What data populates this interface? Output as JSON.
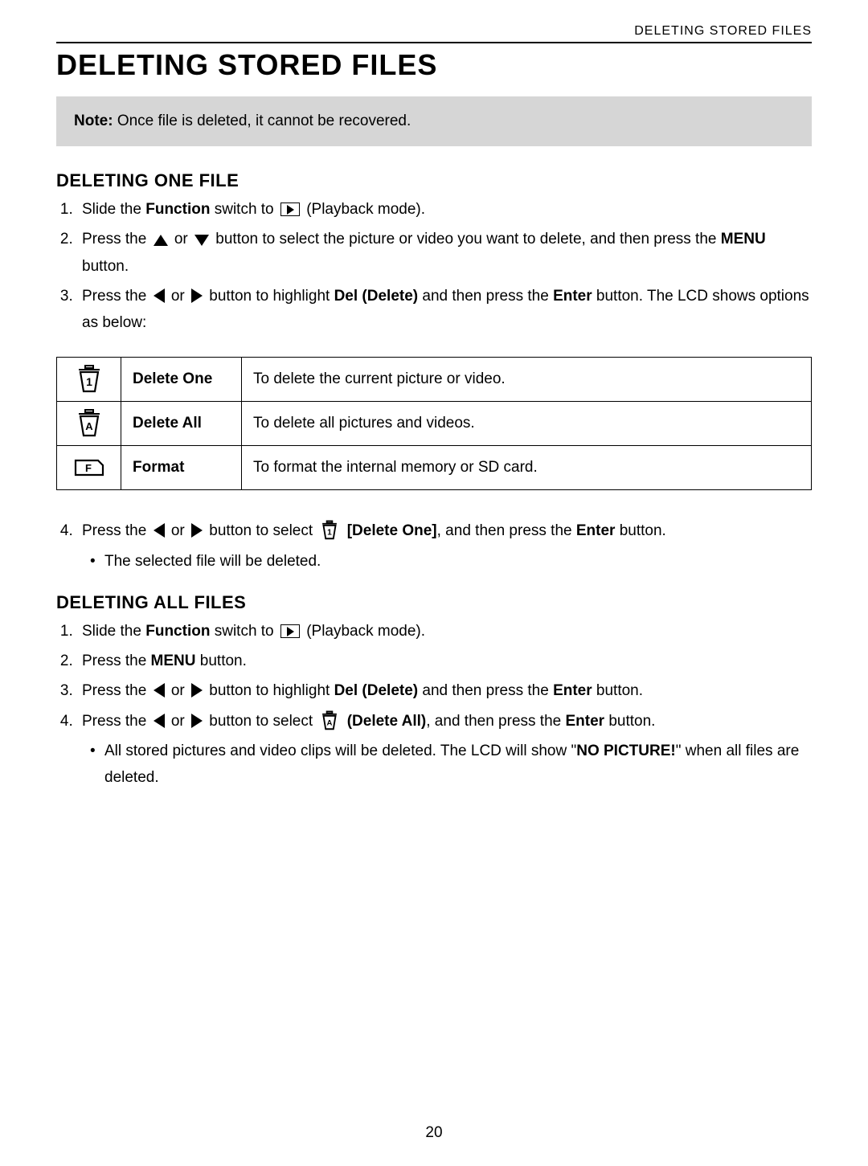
{
  "header": "DELETING STORED FILES",
  "title": "DELETING STORED FILES",
  "note_prefix": "Note:",
  "note_body": " Once file is deleted, it cannot be recovered.",
  "sec1_heading": "DELETING ONE FILE",
  "sec1": {
    "s1a": "Slide the ",
    "s1b": "Function",
    "s1c": " switch to ",
    "s1d": " (Playback mode).",
    "s2a": "Press the ",
    "s2b": " or ",
    "s2c": " button to select the picture or video you want to delete, and then press the ",
    "s2d": "MENU",
    "s2e": " button.",
    "s3a": "Press the ",
    "s3b": " or ",
    "s3c": " button to highlight ",
    "s3d": "Del (Delete)",
    "s3e": " and then press the ",
    "s3f": "Enter",
    "s3g": " button. The LCD shows options as below:",
    "s4a": "Press the ",
    "s4b": " or ",
    "s4c": " button to select ",
    "s4d": " [Delete One]",
    "s4e": ", and then press the ",
    "s4f": "Enter",
    "s4g": " button.",
    "s4_sub": "The selected file will be deleted."
  },
  "table": {
    "r1_label": "Delete One",
    "r1_desc": "To delete the current picture or video.",
    "r2_label": "Delete All",
    "r2_desc": "To delete all pictures and videos.",
    "r3_label": "Format",
    "r3_desc": "To format the internal memory or SD card."
  },
  "sec2_heading": "DELETING ALL FILES",
  "sec2": {
    "s1a": "Slide the ",
    "s1b": "Function",
    "s1c": " switch to ",
    "s1d": " (Playback mode).",
    "s2a": "Press the ",
    "s2b": "MENU",
    "s2c": " button.",
    "s3a": "Press the ",
    "s3b": " or ",
    "s3c": " button to highlight ",
    "s3d": "Del (Delete)",
    "s3e": " and then press the ",
    "s3f": "Enter",
    "s3g": " button.",
    "s4a": "Press the ",
    "s4b": " or ",
    "s4c": " button to select ",
    "s4d": " (Delete All)",
    "s4e": ", and then press the ",
    "s4f": "Enter",
    "s4g": " button.",
    "s4_sub_a": "All stored pictures and video clips will be deleted. The LCD will show \"",
    "s4_sub_b": "NO PICTURE!",
    "s4_sub_c": "\" when all files are deleted."
  },
  "page_number": "20"
}
